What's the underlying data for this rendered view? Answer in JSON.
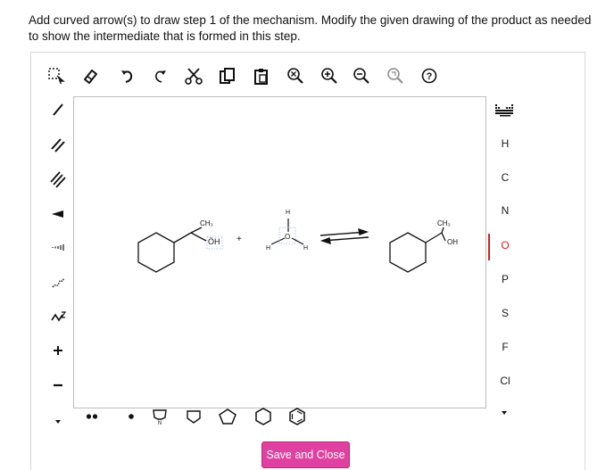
{
  "prompt": {
    "line1": "Add curved arrow(s) to draw step 1 of the mechanism. Modify the given drawing of the product as needed",
    "line2": "to show the intermediate that is formed in this step."
  },
  "toolbar": {
    "icons": [
      "select-icon",
      "eraser-icon",
      "undo-icon",
      "redo-icon",
      "cut-icon",
      "copy-icon",
      "paste-icon",
      "zoom-fit-icon",
      "zoom-in-icon",
      "zoom-out-icon",
      "zoom-reset-icon",
      "help-icon"
    ],
    "help_label": "?"
  },
  "left_tools": [
    "single-bond-icon",
    "double-bond-icon",
    "triple-bond-icon",
    "wedge-bond-icon",
    "hash-bond-icon",
    "wavy-bond-icon",
    "chain-icon",
    "positive-charge-icon",
    "negative-charge-icon"
  ],
  "atoms": {
    "periodic_icon": "periodic-table-icon",
    "list": [
      "H",
      "C",
      "N",
      "O",
      "P",
      "S",
      "F",
      "Cl"
    ],
    "selected": "O"
  },
  "molecules": {
    "reactant_ch3": "CH₃",
    "reactant_oh": "ÖH",
    "plus": "+",
    "h_top": "H",
    "h_left": "H",
    "h_right": "H",
    "o_plus": "O",
    "product_ch3": "CH₃",
    "product_oh": "OH"
  },
  "bottom_tools": [
    "radical-dot-icon",
    "lone-pair-icon",
    "single-electron-icon",
    "pyrrole-ring-icon",
    "cyclopentane-icon",
    "benzene-icon",
    "cyclohexane-icon",
    "cyclopentane-alt-icon",
    "cyclohexene-icon"
  ],
  "save_button": {
    "label": "Save and Close"
  },
  "colors": {
    "accent": "#e0409f",
    "selected_atom": "#d81e1e"
  }
}
